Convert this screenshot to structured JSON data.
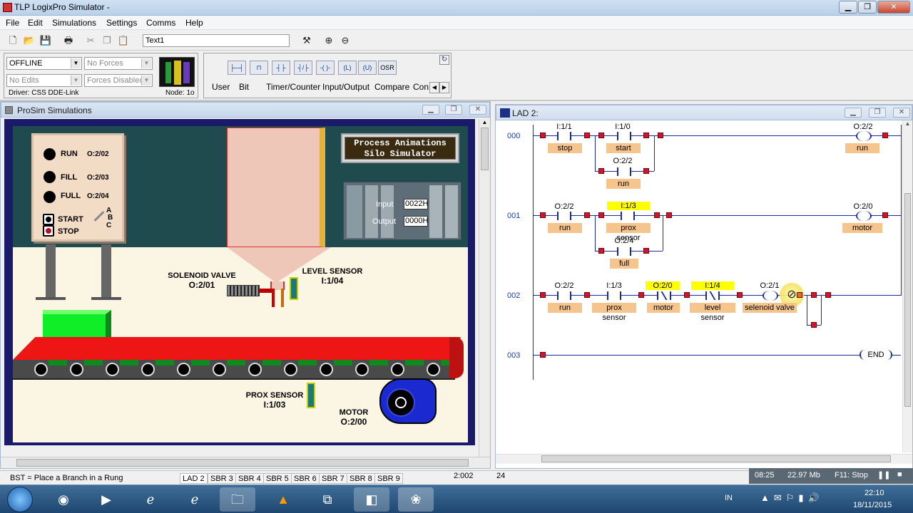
{
  "app": {
    "title": "TLP LogixPro Simulator -"
  },
  "menu": [
    "File",
    "Edit",
    "Simulations",
    "Settings",
    "Comms",
    "Help"
  ],
  "toolbar": {
    "text_field": "Text1"
  },
  "status_panel": {
    "mode": "OFFLINE",
    "forces": "No Forces",
    "edits": "No Edits",
    "forces_state": "Forces Disabled",
    "driver": "Driver: CSS DDE-Link",
    "node": "Node: 1o"
  },
  "instr_buttons": [
    "OSR"
  ],
  "instr_tabs": [
    "User",
    "Bit",
    "Timer/Counter",
    "Input/Output",
    "Compare",
    "Con"
  ],
  "prosim": {
    "title": "ProSim Simulations",
    "indicators": [
      {
        "label": "RUN",
        "addr": "O:2/02"
      },
      {
        "label": "FILL",
        "addr": "O:2/03"
      },
      {
        "label": "FULL",
        "addr": "O:2/04"
      }
    ],
    "buttons": [
      {
        "label": "START"
      },
      {
        "label": "STOP"
      }
    ],
    "selector": [
      "A",
      "B",
      "C"
    ],
    "banner": [
      "Process Animations",
      "Silo Simulator"
    ],
    "io": {
      "input_label": "Input",
      "input_value": "0022H",
      "output_label": "Output",
      "output_value": "0000H"
    },
    "labels": {
      "solenoid": [
        "SOLENOID VALVE",
        "O:2/01"
      ],
      "level": [
        "LEVEL SENSOR",
        "I:1/04"
      ],
      "prox": [
        "PROX SENSOR",
        "I:1/03"
      ],
      "motor": [
        "MOTOR",
        "O:2/00"
      ]
    }
  },
  "lad": {
    "title": "LAD 2:",
    "rungs": [
      {
        "num": "000",
        "cells": [
          {
            "addr": "I:1/1",
            "tag": "stop"
          },
          {
            "addr": "I:1/0",
            "tag": "start"
          },
          {
            "addr": "O:2/2",
            "tag": "run"
          },
          {
            "addr": "O:2/2",
            "tag": "run"
          }
        ]
      },
      {
        "num": "001",
        "cells": [
          {
            "addr": "O:2/2",
            "tag": "run"
          },
          {
            "addr": "I:1/3",
            "tag": "prox sensor"
          },
          {
            "addr": "O:2/4",
            "tag": "full"
          },
          {
            "addr": "O:2/0",
            "tag": "motor"
          }
        ]
      },
      {
        "num": "002",
        "cells": [
          {
            "addr": "O:2/2",
            "tag": "run"
          },
          {
            "addr": "I:1/3",
            "tag": "prox sensor"
          },
          {
            "addr": "O:2/0",
            "tag": "motor"
          },
          {
            "addr": "I:1/4",
            "tag": "level sensor"
          },
          {
            "addr": "O:2/1",
            "tag": "selenoid valve"
          }
        ]
      },
      {
        "num": "003",
        "cells": [
          {
            "tag": "END"
          }
        ]
      }
    ]
  },
  "statusbar": {
    "hint": "BST = Place a Branch in a Rung",
    "tabs": [
      "LAD 2",
      "SBR 3",
      "SBR 4",
      "SBR 5",
      "SBR 6",
      "SBR 7",
      "SBR 8",
      "SBR 9"
    ],
    "addr": "2:002",
    "num": "24"
  },
  "recorder": {
    "time": "08:25",
    "size": "22.97 Mb",
    "hotkey": "F11: Stop"
  },
  "taskbar": {
    "lang": "IN",
    "clock": "22:10",
    "date": "18/11/2015"
  }
}
